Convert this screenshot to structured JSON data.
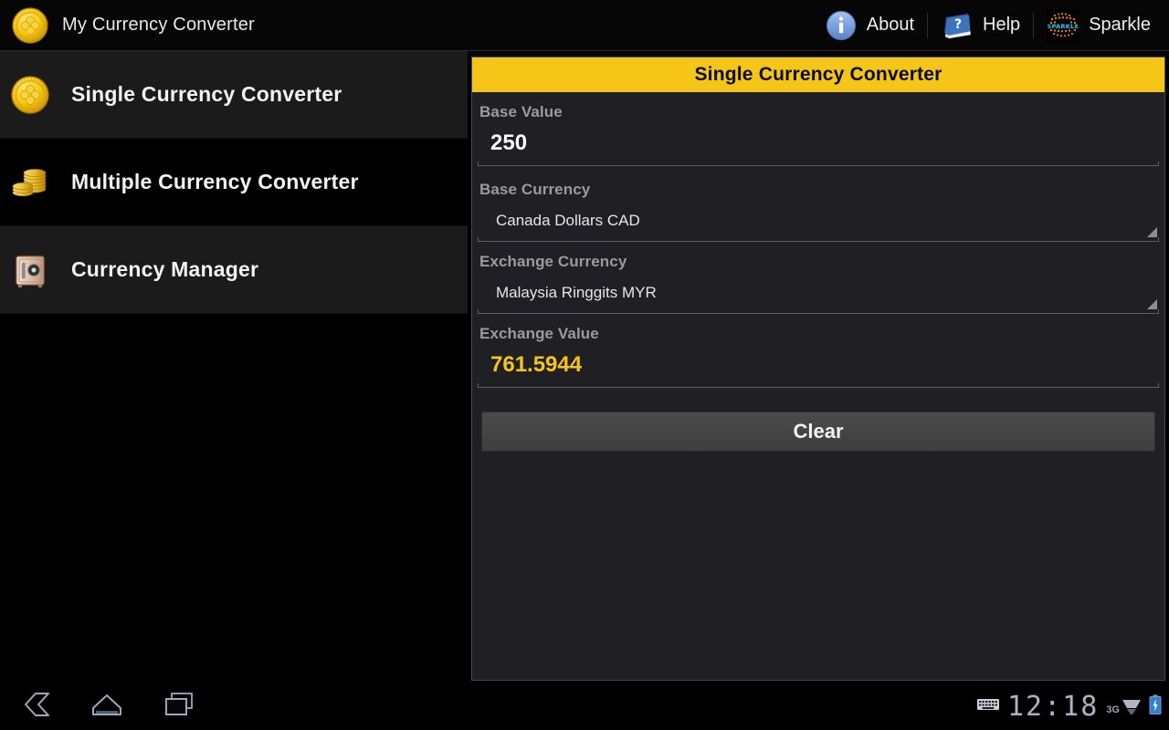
{
  "app": {
    "title": "My Currency Converter",
    "icon": "gold-coin-clover-icon",
    "accent_color": "#f5c518",
    "panel_bg": "#202024",
    "sidebar_bg": "#000000"
  },
  "action_bar": {
    "items": [
      {
        "label": "About",
        "icon": "info-circle-icon"
      },
      {
        "label": "Help",
        "icon": "help-book-icon"
      },
      {
        "label": "Sparkle",
        "icon": "sparkle-globe-icon",
        "icon_text": "SPARKLE"
      }
    ]
  },
  "sidebar": {
    "items": [
      {
        "label": "Single Currency Converter",
        "icon": "gold-coin-clover-icon",
        "state": "shaded"
      },
      {
        "label": "Multiple Currency Converter",
        "icon": "coin-stack-icon",
        "state": "plain"
      },
      {
        "label": "Currency Manager",
        "icon": "safe-vault-icon",
        "state": "shaded"
      }
    ]
  },
  "panel": {
    "title": "Single Currency Converter",
    "fields": {
      "base_value": {
        "label": "Base Value",
        "value": "250"
      },
      "base_currency": {
        "label": "Base Currency",
        "value": "Canada Dollars CAD"
      },
      "exchange_currency": {
        "label": "Exchange Currency",
        "value": "Malaysia Ringgits MYR"
      },
      "exchange_value": {
        "label": "Exchange Value",
        "value": "761.5944"
      }
    },
    "clear_button": "Clear"
  },
  "system_bar": {
    "back_icon": "back-chevron-icon",
    "home_icon": "home-icon",
    "recents_icon": "recent-apps-icon",
    "keyboard_icon": "keyboard-icon",
    "clock": "12:18",
    "network": "3G",
    "signal_icon": "signal-bars-icon",
    "battery_icon": "battery-charging-icon"
  }
}
